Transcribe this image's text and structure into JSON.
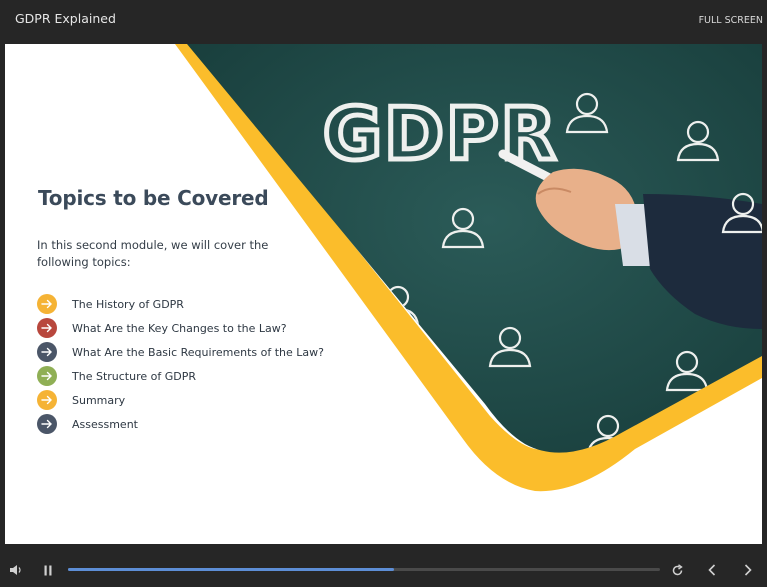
{
  "app": {
    "title": "GDPR Explained",
    "fullscreen_label": "FULL SCREEN"
  },
  "slide": {
    "title": "Topics to be Covered",
    "intro": "In this second module, we will cover the following topics:",
    "image_text": "GDPR",
    "topics": [
      {
        "label": "The History of GDPR",
        "color": "#f5b335",
        "icon": "arrow-right-icon"
      },
      {
        "label": "What Are the Key Changes to the Law?",
        "color": "#b8473d",
        "icon": "arrow-right-icon"
      },
      {
        "label": "What Are the Basic Requirements of the Law?",
        "color": "#4b5668",
        "icon": "arrow-right-icon"
      },
      {
        "label": "The Structure of GDPR",
        "color": "#8faf55",
        "icon": "arrow-right-icon"
      },
      {
        "label": "Summary",
        "color": "#f5b335",
        "icon": "arrow-right-icon"
      },
      {
        "label": "Assessment",
        "color": "#4b5668",
        "icon": "arrow-right-icon"
      }
    ]
  },
  "player": {
    "progress": 0.55,
    "icons": [
      "volume-icon",
      "pause-icon",
      "replay-icon",
      "previous-icon",
      "next-icon"
    ],
    "accent_color": "#5d8ed6"
  },
  "colors": {
    "chalkboard": "#1f4a48",
    "yellow_band": "#fbbd2b",
    "title_text": "#3b4a5a"
  }
}
